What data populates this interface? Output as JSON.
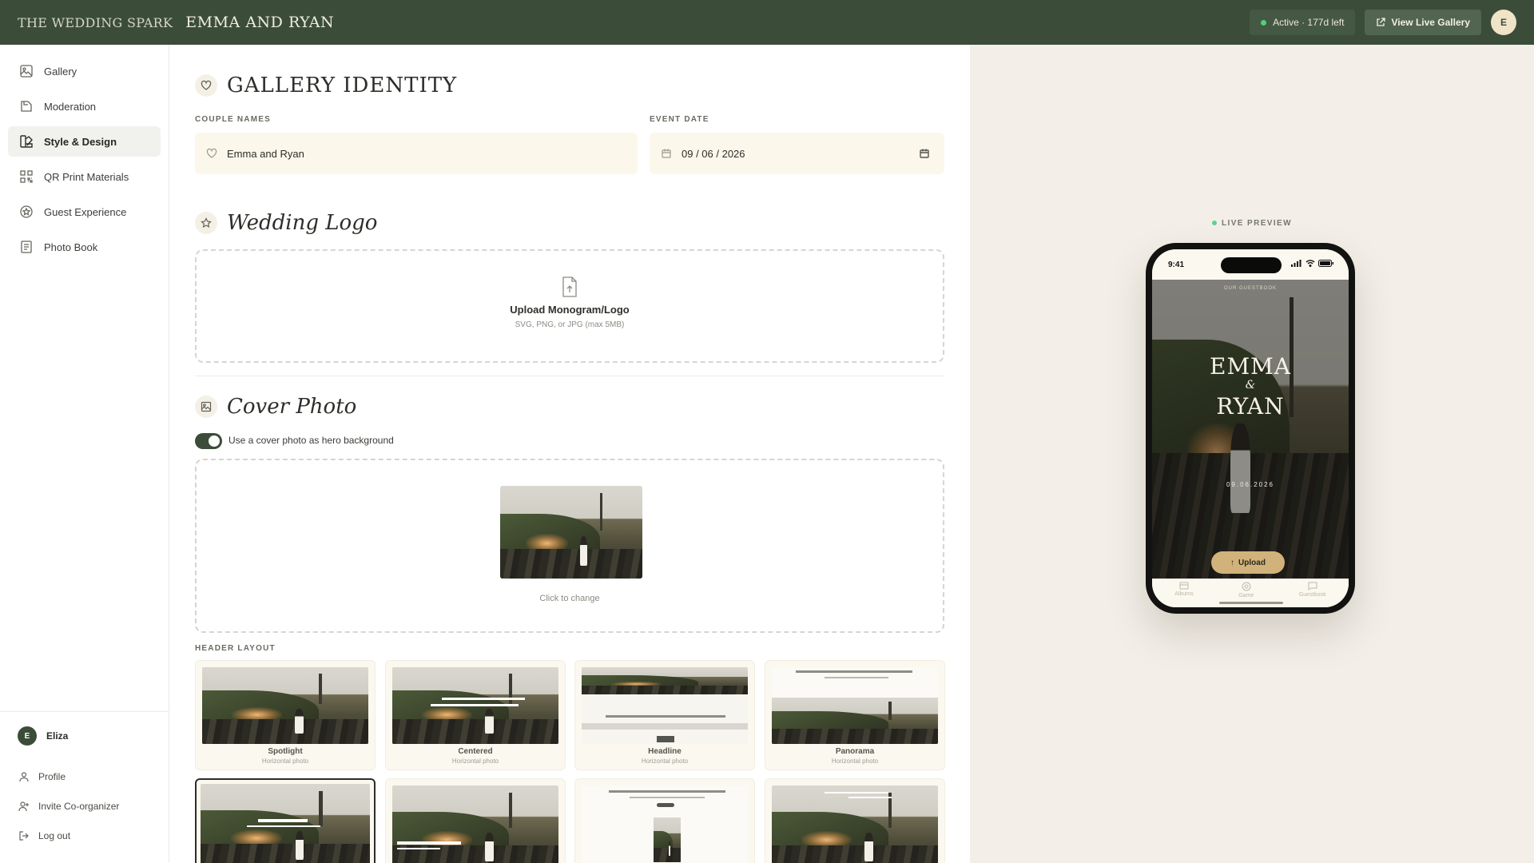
{
  "topbar": {
    "brand": "THE WEDDING SPARK",
    "couple": "EMMA AND RYAN",
    "status": "Active · 177d left",
    "live_button": "View Live Gallery",
    "avatar_initial": "E"
  },
  "sidebar": {
    "items": [
      {
        "label": "Gallery",
        "icon": "image-icon"
      },
      {
        "label": "Moderation",
        "icon": "folder-icon"
      },
      {
        "label": "Style & Design",
        "icon": "palette-icon",
        "active": true
      },
      {
        "label": "QR Print Materials",
        "icon": "qr-icon"
      },
      {
        "label": "Guest Experience",
        "icon": "star-icon"
      },
      {
        "label": "Photo Book",
        "icon": "book-icon"
      }
    ],
    "user": {
      "initial": "E",
      "name": "Eliza"
    },
    "links": [
      {
        "label": "Profile"
      },
      {
        "label": "Invite Co-organizer"
      },
      {
        "label": "Log out"
      }
    ]
  },
  "identity": {
    "title": "GALLERY IDENTITY",
    "couple_label": "COUPLE NAMES",
    "couple_value": "Emma and Ryan",
    "date_label": "EVENT DATE",
    "date_value": "09 / 06 / 2026"
  },
  "logo": {
    "title": "Wedding Logo",
    "upload_title": "Upload Monogram/Logo",
    "upload_sub": "SVG, PNG, or JPG (max 5MB)"
  },
  "cover": {
    "title": "Cover Photo",
    "toggle_label": "Use a cover photo as hero background",
    "toggle_on": true,
    "click_change": "Click to change"
  },
  "header_layout": {
    "label": "HEADER LAYOUT",
    "cards": [
      {
        "name": "Spotlight",
        "sub": "Horizontal photo"
      },
      {
        "name": "Centered",
        "sub": "Horizontal photo"
      },
      {
        "name": "Headline",
        "sub": "Horizontal photo"
      },
      {
        "name": "Panorama",
        "sub": "Horizontal photo"
      }
    ]
  },
  "preview": {
    "label": "LIVE PREVIEW",
    "time": "9:41",
    "guestbook": "OUR GUESTBOOK",
    "name1": "EMMA",
    "amp": "&",
    "name2": "RYAN",
    "date": "09.06.2026",
    "upload": "Upload",
    "tabs": [
      "Albums",
      "Game",
      "Guestbook"
    ]
  },
  "colors": {
    "topbar": "#3b4d39",
    "accent_gold": "#d1b27a",
    "field_bg": "#fbf7ea",
    "preview_bg": "#f3efe8"
  }
}
